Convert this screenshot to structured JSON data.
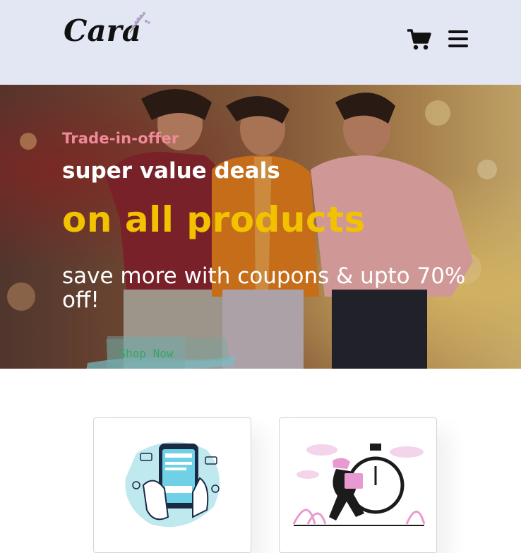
{
  "brand": {
    "logo_text": "Cara"
  },
  "header": {
    "cart_icon": "shopping-cart-icon",
    "menu_icon": "hamburger-menu-icon"
  },
  "hero": {
    "eyebrow": "Trade-in-offer",
    "title": "super value deals",
    "title_highlight": "on all products",
    "subtitle": "save more with coupons & upto 70% off!",
    "cta_label": "Shop Now"
  },
  "features": [
    {
      "icon": "online-payment-illustration"
    },
    {
      "icon": "fast-delivery-illustration"
    }
  ],
  "colors": {
    "header_bg": "#e3e6f3",
    "eyebrow": "#f08a98",
    "highlight": "#f2c200",
    "cta_text": "#2fa86a"
  }
}
